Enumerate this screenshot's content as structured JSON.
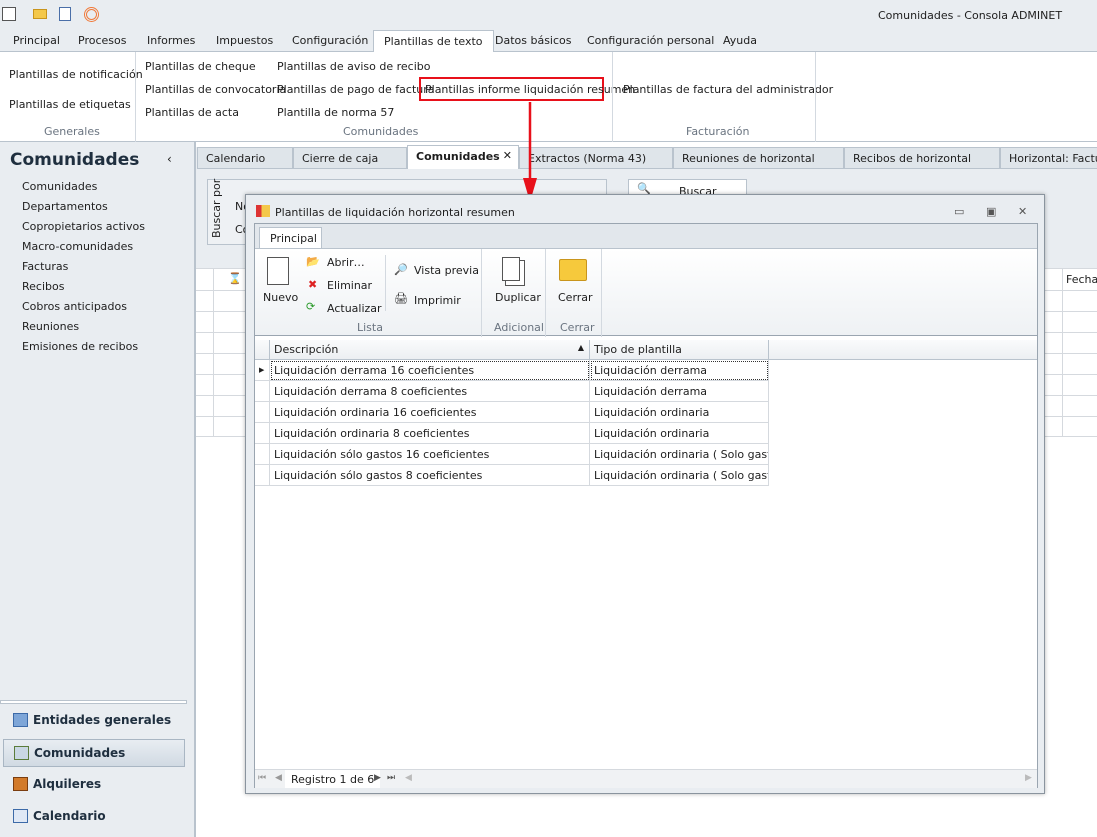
{
  "window_title": "Comunidades - Consola ADMINET",
  "ribbon_tabs": [
    "Principal",
    "Procesos",
    "Informes",
    "Impuestos",
    "Configuración",
    "Plantillas de texto",
    "Datos básicos",
    "Configuración personal",
    "Ayuda"
  ],
  "ribbon": {
    "generales": {
      "label": "Generales",
      "items": [
        "Plantillas de notificación",
        "Plantillas de etiquetas"
      ]
    },
    "comunidades": {
      "label": "Comunidades",
      "items": [
        "Plantillas de cheque",
        "Plantillas de convocatoria",
        "Plantillas de acta",
        "Plantillas de aviso de recibo",
        "Plantillas de pago de factura",
        "Plantilla de norma 57",
        "Plantillas informe liquidación resumen"
      ]
    },
    "facturacion": {
      "label": "Facturación",
      "items": [
        "Plantillas de factura del administrador"
      ]
    }
  },
  "sidebar": {
    "title": "Comunidades",
    "items": [
      "Comunidades",
      "Departamentos",
      "Copropietarios activos",
      "Macro-comunidades",
      "Facturas",
      "Recibos",
      "Cobros anticipados",
      "Reuniones",
      "Emisiones de recibos"
    ],
    "nav": [
      "Entidades generales",
      "Comunidades",
      "Alquileres",
      "Calendario"
    ]
  },
  "doc_tabs": [
    "Calendario",
    "Cierre de caja",
    "Comunidades",
    "Extractos (Norma 43)",
    "Reuniones de horizontal",
    "Recibos de horizontal",
    "Horizontal: Factura"
  ],
  "search": {
    "group_label": "Buscar por",
    "field1": "No",
    "field2": "Co",
    "button": "Buscar"
  },
  "bg_grid": {
    "col_fecha": "Fecha"
  },
  "dialog": {
    "title": "Plantillas de liquidación horizontal resumen",
    "tab": "Principal",
    "buttons": {
      "nuevo": "Nuevo",
      "abrir": "Abrir…",
      "eliminar": "Eliminar",
      "actualizar": "Actualizar",
      "vista_previa": "Vista previa",
      "imprimir": "Imprimir",
      "duplicar": "Duplicar",
      "cerrar": "Cerrar"
    },
    "groups": {
      "lista": "Lista",
      "adicional": "Adicional",
      "cerrar": "Cerrar"
    },
    "columns": [
      "Descripción",
      "Tipo de plantilla"
    ],
    "rows": [
      [
        "Liquidación derrama 16 coeficientes",
        "Liquidación derrama"
      ],
      [
        "Liquidación derrama 8 coeficientes",
        "Liquidación derrama"
      ],
      [
        "Liquidación ordinaria 16 coeficientes",
        "Liquidación ordinaria"
      ],
      [
        "Liquidación ordinaria 8 coeficientes",
        "Liquidación ordinaria"
      ],
      [
        "Liquidación sólo gastos 16 coeficientes",
        "Liquidación ordinaria ( Solo gastos )"
      ],
      [
        "Liquidación sólo gastos 8 coeficientes",
        "Liquidación ordinaria ( Solo gastos )"
      ]
    ],
    "record_nav": "Registro 1 de 6"
  },
  "colors": {
    "highlight": "#e8101a"
  }
}
